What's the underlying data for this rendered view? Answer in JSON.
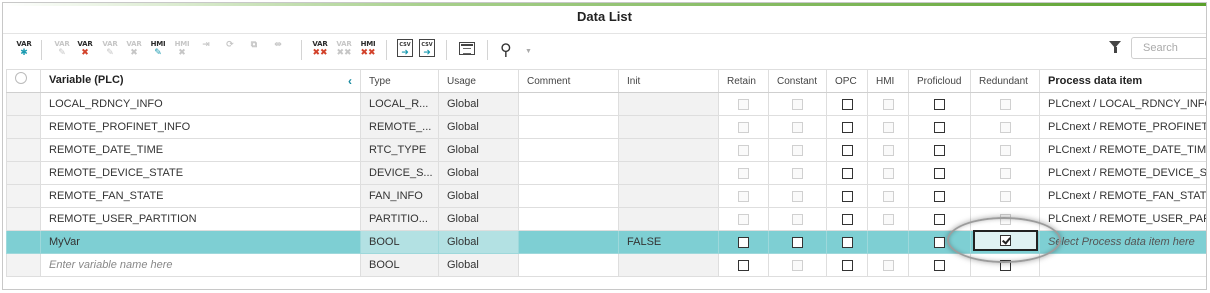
{
  "title": "Data List",
  "toolbar": {
    "buttons": [
      {
        "name": "add-variable-button",
        "label": "VAR",
        "sym": "✱",
        "tone": "dark",
        "symTone": "teal",
        "enabled": true
      },
      {
        "name": "edit-variable-disabled",
        "label": "VAR",
        "sym": "✎",
        "tone": "fade",
        "symTone": "fade",
        "enabled": false
      },
      {
        "name": "delete-variable-button",
        "label": "VAR",
        "sym": "✖",
        "tone": "dark",
        "symTone": "redx",
        "enabled": true
      },
      {
        "name": "edit-variable-button-2",
        "label": "VAR",
        "sym": "✎",
        "tone": "fade",
        "symTone": "fade",
        "enabled": false
      },
      {
        "name": "delete-variable-disabled",
        "label": "VAR",
        "sym": "✖",
        "tone": "fade",
        "symTone": "fade",
        "enabled": false
      },
      {
        "name": "hmi-edit-button",
        "label": "HMI",
        "sym": "✎",
        "tone": "dark",
        "symTone": "teal",
        "enabled": true
      },
      {
        "name": "hmi-delete-disabled",
        "label": "HMI",
        "sym": "✖",
        "tone": "fade",
        "symTone": "fade",
        "enabled": false
      },
      {
        "name": "move-right-disabled",
        "label": "",
        "sym": "⇥",
        "tone": "fade",
        "symTone": "fade",
        "enabled": false
      },
      {
        "name": "cycle-disabled",
        "label": "",
        "sym": "⟳",
        "tone": "fade",
        "symTone": "fade",
        "enabled": false
      },
      {
        "name": "copy-disabled",
        "label": "",
        "sym": "⧉",
        "tone": "fade",
        "symTone": "fade",
        "enabled": false
      },
      {
        "name": "link-disabled",
        "label": "",
        "sym": "⇹",
        "tone": "fade",
        "symTone": "fade",
        "enabled": false
      },
      {
        "name": "delete-var-all-button",
        "label": "VAR",
        "sym": "✖✖",
        "tone": "dark",
        "symTone": "redx",
        "enabled": true
      },
      {
        "name": "delete-var-all-disabled",
        "label": "VAR",
        "sym": "✖✖",
        "tone": "fade",
        "symTone": "fade",
        "enabled": false
      },
      {
        "name": "delete-hmi-all-button",
        "label": "HMI",
        "sym": "✖✖",
        "tone": "dark",
        "symTone": "redx",
        "enabled": true
      }
    ],
    "csv_import": "CSV",
    "csv_export": "CSV",
    "search_placeholder": "Search"
  },
  "columns": [
    "Variable (PLC)",
    "Type",
    "Usage",
    "Comment",
    "Init",
    "Retain",
    "Constant",
    "OPC",
    "HMI",
    "Proficloud",
    "Redundant",
    "Process data item"
  ],
  "rows": [
    {
      "name": "LOCAL_RDNCY_INFO",
      "type": "LOCAL_R...",
      "usage": "Global",
      "comment": "",
      "init": "",
      "retain": "dis",
      "constant": "dis",
      "opc": "off",
      "hmi": "dis",
      "proficloud": "off",
      "redundant": "dis",
      "pdi": "PLCnext / LOCAL_RDNCY_INFO",
      "selected": false,
      "placeholder": false
    },
    {
      "name": "REMOTE_PROFINET_INFO",
      "type": "REMOTE_...",
      "usage": "Global",
      "comment": "",
      "init": "",
      "retain": "dis",
      "constant": "dis",
      "opc": "off",
      "hmi": "dis",
      "proficloud": "off",
      "redundant": "dis",
      "pdi": "PLCnext / REMOTE_PROFINET_INFO",
      "selected": false,
      "placeholder": false
    },
    {
      "name": "REMOTE_DATE_TIME",
      "type": "RTC_TYPE",
      "usage": "Global",
      "comment": "",
      "init": "",
      "retain": "dis",
      "constant": "dis",
      "opc": "off",
      "hmi": "dis",
      "proficloud": "off",
      "redundant": "dis",
      "pdi": "PLCnext / REMOTE_DATE_TIME",
      "selected": false,
      "placeholder": false
    },
    {
      "name": "REMOTE_DEVICE_STATE",
      "type": "DEVICE_S...",
      "usage": "Global",
      "comment": "",
      "init": "",
      "retain": "dis",
      "constant": "dis",
      "opc": "off",
      "hmi": "dis",
      "proficloud": "off",
      "redundant": "dis",
      "pdi": "PLCnext / REMOTE_DEVICE_STATE",
      "selected": false,
      "placeholder": false
    },
    {
      "name": "REMOTE_FAN_STATE",
      "type": "FAN_INFO",
      "usage": "Global",
      "comment": "",
      "init": "",
      "retain": "dis",
      "constant": "dis",
      "opc": "off",
      "hmi": "dis",
      "proficloud": "off",
      "redundant": "dis",
      "pdi": "PLCnext / REMOTE_FAN_STATE",
      "selected": false,
      "placeholder": false
    },
    {
      "name": "REMOTE_USER_PARTITION",
      "type": "PARTITIO...",
      "usage": "Global",
      "comment": "",
      "init": "",
      "retain": "dis",
      "constant": "dis",
      "opc": "off",
      "hmi": "dis",
      "proficloud": "off",
      "redundant": "dis",
      "pdi": "PLCnext / REMOTE_USER_PARTITION",
      "selected": false,
      "placeholder": false
    },
    {
      "name": "MyVar",
      "type": "BOOL",
      "usage": "Global",
      "comment": "",
      "init": "FALSE",
      "retain": "off",
      "constant": "off",
      "opc": "off",
      "hmi": "none",
      "proficloud": "off",
      "redundant": "on",
      "pdi": "Select Process data item here",
      "selected": true,
      "placeholder": false
    },
    {
      "name": "Enter variable name here",
      "type": "BOOL",
      "usage": "Global",
      "comment": "",
      "init": "",
      "retain": "off",
      "constant": "dis",
      "opc": "off",
      "hmi": "dis",
      "proficloud": "off",
      "redundant": "off",
      "pdi": "",
      "selected": false,
      "placeholder": true
    }
  ]
}
